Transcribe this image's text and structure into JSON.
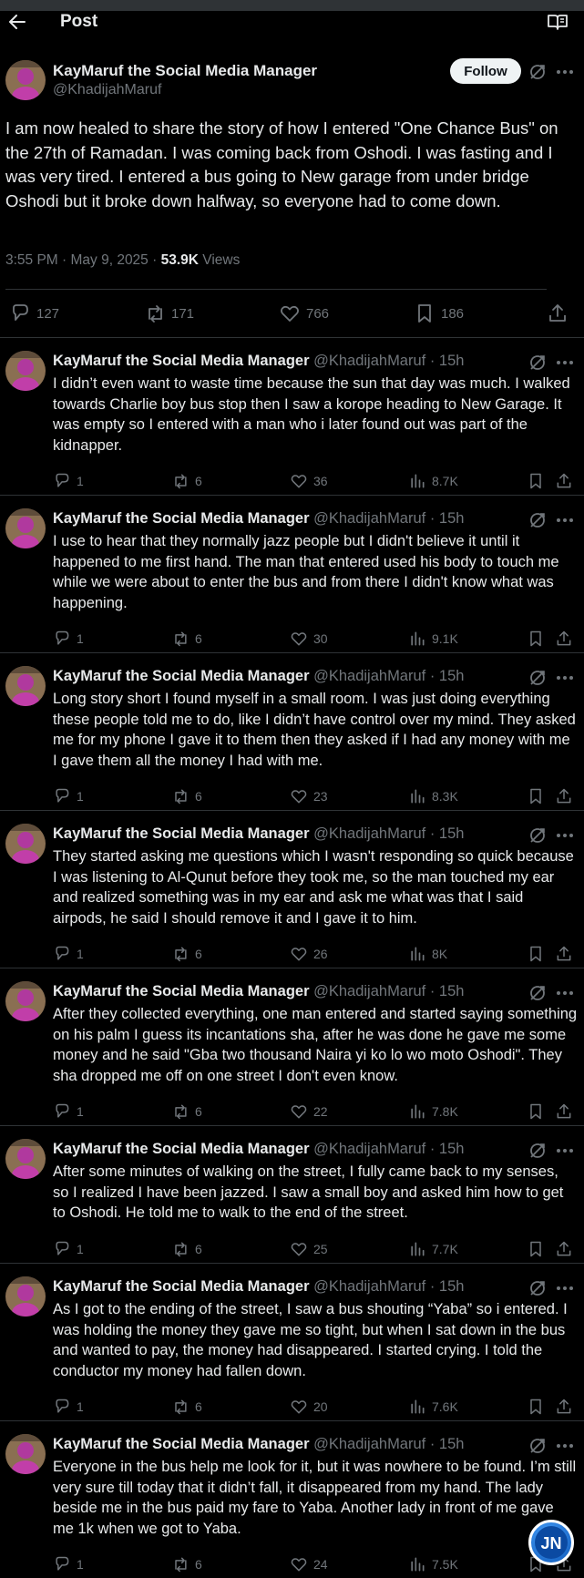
{
  "header": {
    "title": "Post"
  },
  "colors": {
    "background": "#000000",
    "text": "#e7e9ea",
    "muted": "#71767b",
    "border": "#2f3336",
    "follow_bg": "#eff3f4"
  },
  "icons": [
    "back-arrow-icon",
    "reader-icon",
    "grok-icon",
    "more-icon",
    "reply-icon",
    "repost-icon",
    "like-icon",
    "bookmark-icon",
    "share-icon",
    "views-icon"
  ],
  "main_post": {
    "author_name": "KayMaruf the Social Media Manager",
    "author_handle": "@KhadijahMaruf",
    "follow_label": "Follow",
    "text": "I am now healed to share the story of how I entered \"One Chance Bus\" on the 27th of Ramadan. I was coming back from Oshodi. I was fasting and I was very tired. I entered a bus going to New garage from under bridge Oshodi but it broke down halfway, so everyone had to come down.",
    "timestamp": "3:55 PM · May 9, 2025 · ",
    "views_count": "53.9K",
    "views_label": " Views",
    "replies": "127",
    "reposts": "171",
    "likes": "766",
    "bookmarks": "186"
  },
  "replies": [
    {
      "name": "KayMaruf the Social Media Manager",
      "handle": "@KhadijahMaruf · 15h",
      "text": "I didn’t even want to waste time because the sun that day was much. I walked towards Charlie boy bus stop then I saw a korope heading to New Garage. It was empty so I entered with a man who i later found out was part of the kidnapper.",
      "replies": "1",
      "reposts": "6",
      "likes": "36",
      "views": "8.7K"
    },
    {
      "name": "KayMaruf the Social Media Manager",
      "handle": "@KhadijahMaruf · 15h",
      "text": "I use to hear that they normally jazz people but I didn't believe it until it happened to me first hand. The man that entered used his body to touch me while we were about to enter the bus and from there I didn't know what was happening.",
      "replies": "1",
      "reposts": "6",
      "likes": "30",
      "views": "9.1K"
    },
    {
      "name": "KayMaruf the Social Media Manager",
      "handle": "@KhadijahMaruf · 15h",
      "text": "Long story short I found myself in a small room. I was just doing everything these people told me to do, like I didn’t have control over my mind. They asked me for my phone I gave it to them then they asked if I had any money with me I gave them all the money I had with me.",
      "replies": "1",
      "reposts": "6",
      "likes": "23",
      "views": "8.3K"
    },
    {
      "name": "KayMaruf the Social Media Manager",
      "handle": "@KhadijahMaruf · 15h",
      "text": "They started asking me questions which I wasn't responding so quick because I was listening to Al-Qunut before they took me, so the man touched my ear and realized something was in my ear and ask me what was that I said airpods, he said I should remove it and I gave it to him.",
      "replies": "1",
      "reposts": "6",
      "likes": "26",
      "views": "8K"
    },
    {
      "name": "KayMaruf the Social Media Manager",
      "handle": "@KhadijahMaruf · 15h",
      "text": "After they collected everything, one man entered and started saying something on his palm I guess its incantations sha, after he was done he gave me some money and he said \"Gba two thousand Naira yi ko lo wo moto Oshodi\".  They sha dropped me off on one street I don't even know.",
      "replies": "1",
      "reposts": "6",
      "likes": "22",
      "views": "7.8K"
    },
    {
      "name": "KayMaruf the Social Media Manager",
      "handle": "@KhadijahMaruf · 15h",
      "text": "After some minutes of walking on the street, I fully came back to my senses, so I realized I have been jazzed. I saw a small boy and asked him how to get to Oshodi. He told me to walk to the end of the street.",
      "replies": "1",
      "reposts": "6",
      "likes": "25",
      "views": "7.7K"
    },
    {
      "name": "KayMaruf the Social Media Manager",
      "handle": "@KhadijahMaruf · 15h",
      "text": "As I got to the ending of the street, I saw a bus shouting “Yaba” so i entered. I was holding the money they gave me so tight, but when I sat down in the bus  and wanted to pay, the money had disappeared. I started crying. I told the conductor my money had fallen down.",
      "replies": "1",
      "reposts": "6",
      "likes": "20",
      "views": "7.6K"
    },
    {
      "name": "KayMaruf the Social Media Manager",
      "handle": "@KhadijahMaruf · 15h",
      "text": "Everyone in the bus help me look for it, but it was nowhere to be found. I’m still very sure till today that it didn’t fall, it disappeared from my hand. The lady beside me in the bus paid my fare to Yaba. Another lady in front of me gave me 1k when we got to Yaba.",
      "replies": "1",
      "reposts": "6",
      "likes": "24",
      "views": "7.5K"
    }
  ],
  "watermark": {
    "text": "JN"
  }
}
